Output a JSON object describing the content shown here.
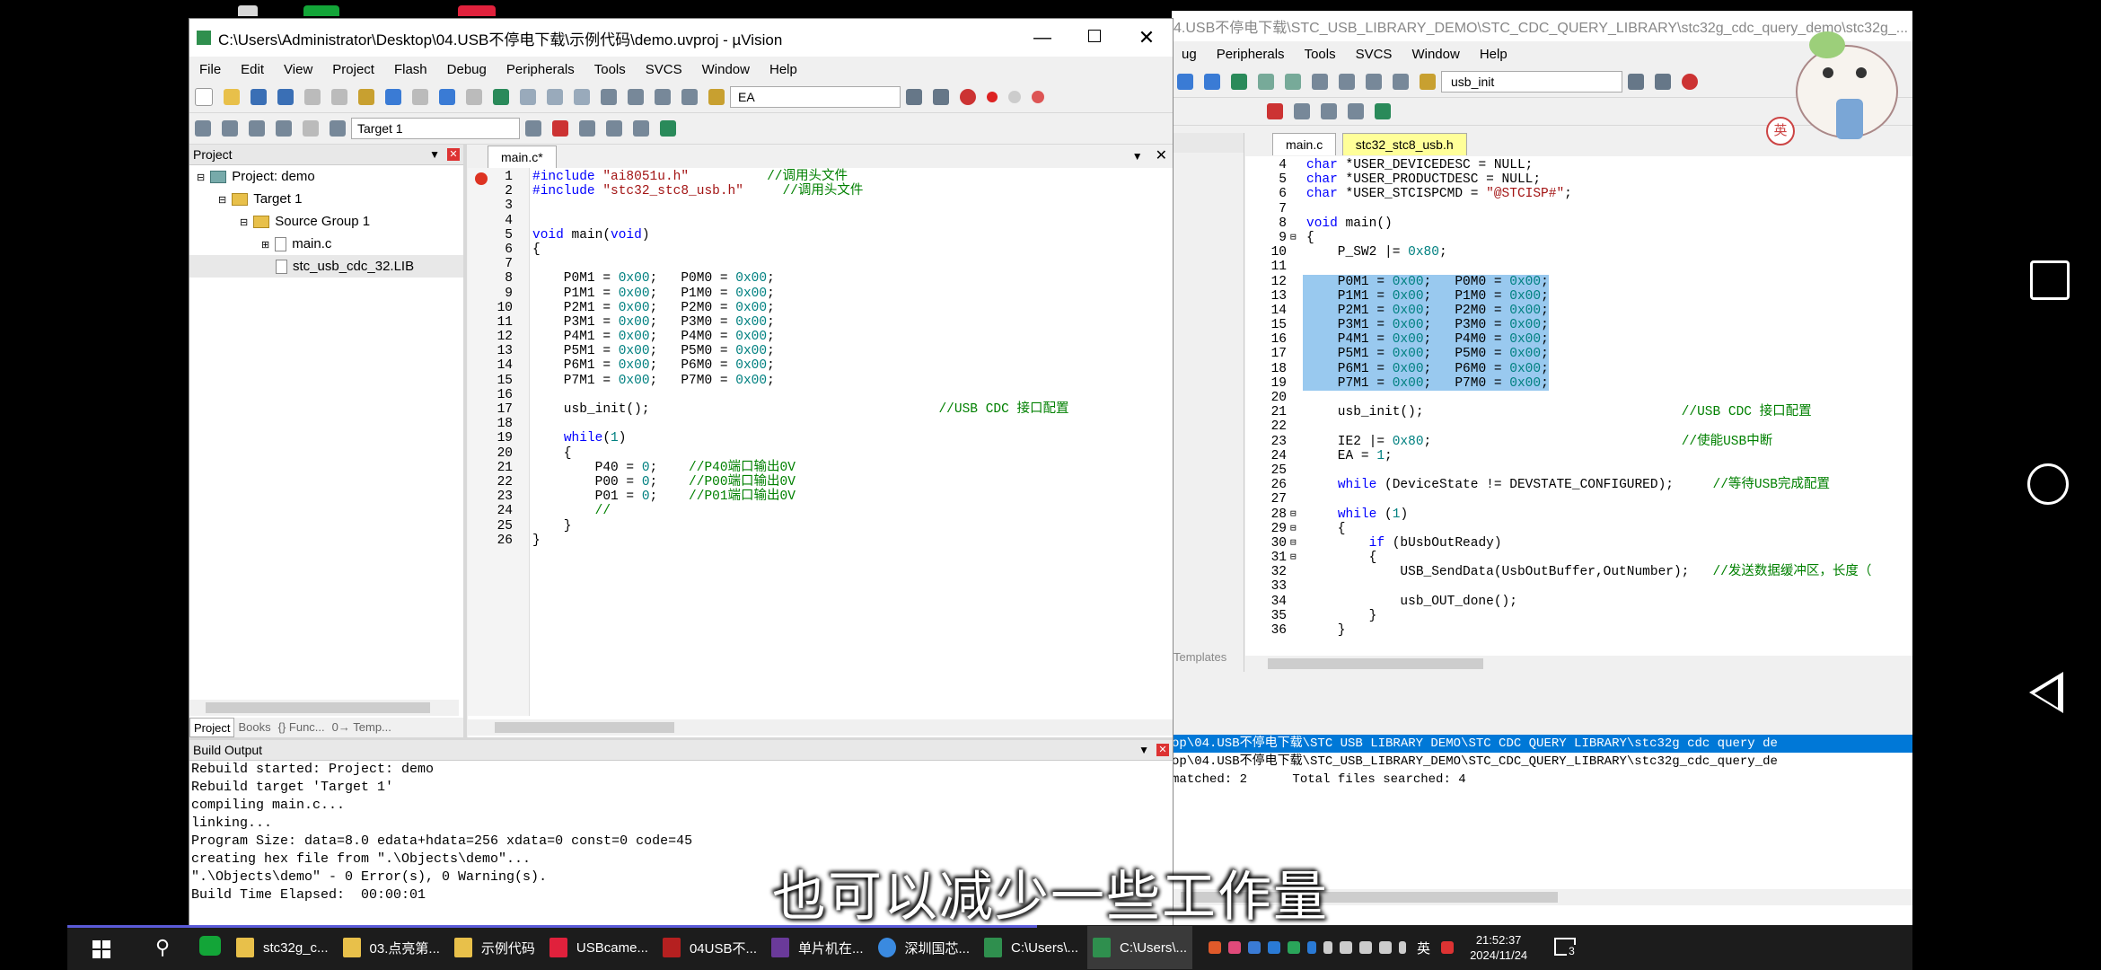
{
  "window1": {
    "title": "C:\\Users\\Administrator\\Desktop\\04.USB不停电下载\\示例代码\\demo.uvproj - µVision",
    "menu": [
      "File",
      "Edit",
      "View",
      "Project",
      "Flash",
      "Debug",
      "Peripherals",
      "Tools",
      "SVCS",
      "Window",
      "Help"
    ],
    "toolbar_search": "EA",
    "target": "Target 1"
  },
  "project": {
    "header": "Project",
    "items": [
      "Project: demo",
      "Target 1",
      "Source Group 1",
      "main.c",
      "stc_usb_cdc_32.LIB"
    ],
    "tabs": [
      "Project",
      "Books",
      "{} Func...",
      "0→ Temp..."
    ]
  },
  "editor1": {
    "tab": "main.c*",
    "lines": [
      {
        "n": "1",
        "code": "#include \"ai8051u.h\"          //调用头文件"
      },
      {
        "n": "2",
        "code": "#include \"stc32_stc8_usb.h\"     //调用头文件"
      },
      {
        "n": "3",
        "code": ""
      },
      {
        "n": "4",
        "code": ""
      },
      {
        "n": "5",
        "code": "void main(void)"
      },
      {
        "n": "6",
        "code": "{"
      },
      {
        "n": "7",
        "code": ""
      },
      {
        "n": "8",
        "code": "    P0M1 = 0x00;   P0M0 = 0x00;"
      },
      {
        "n": "9",
        "code": "    P1M1 = 0x00;   P1M0 = 0x00;"
      },
      {
        "n": "10",
        "code": "    P2M1 = 0x00;   P2M0 = 0x00;"
      },
      {
        "n": "11",
        "code": "    P3M1 = 0x00;   P3M0 = 0x00;"
      },
      {
        "n": "12",
        "code": "    P4M1 = 0x00;   P4M0 = 0x00;"
      },
      {
        "n": "13",
        "code": "    P5M1 = 0x00;   P5M0 = 0x00;"
      },
      {
        "n": "14",
        "code": "    P6M1 = 0x00;   P6M0 = 0x00;"
      },
      {
        "n": "15",
        "code": "    P7M1 = 0x00;   P7M0 = 0x00;"
      },
      {
        "n": "16",
        "code": ""
      },
      {
        "n": "17",
        "code": "    usb_init();                                     //USB CDC 接口配置"
      },
      {
        "n": "18",
        "code": ""
      },
      {
        "n": "19",
        "code": "    while(1)"
      },
      {
        "n": "20",
        "code": "    {"
      },
      {
        "n": "21",
        "code": "        P40 = 0;    //P40端口输出0V"
      },
      {
        "n": "22",
        "code": "        P00 = 0;    //P00端口输出0V"
      },
      {
        "n": "23",
        "code": "        P01 = 0;    //P01端口输出0V"
      },
      {
        "n": "24",
        "code": "        //"
      },
      {
        "n": "25",
        "code": "    }"
      },
      {
        "n": "26",
        "code": "}"
      }
    ]
  },
  "build": {
    "header": "Build Output",
    "lines": [
      "Rebuild started: Project: demo",
      "Rebuild target 'Target 1'",
      "compiling main.c...",
      "linking...",
      "Program Size: data=8.0 edata+hdata=256 xdata=0 const=0 code=45",
      "creating hex file from \".\\Objects\\demo\"...",
      "\".\\Objects\\demo\" - 0 Error(s), 0 Warning(s).",
      "Build Time Elapsed:  00:00:01"
    ]
  },
  "window2": {
    "title": "4.USB不停电下载\\STC_USB_LIBRARY_DEMO\\STC_CDC_QUERY_LIBRARY\\stc32g_cdc_query_demo\\stc32g_...",
    "menu": [
      "ug",
      "Peripherals",
      "Tools",
      "SVCS",
      "Window",
      "Help"
    ],
    "toolbar_search": "usb_init",
    "tabs": [
      "main.c",
      "stc32_stc8_usb.h"
    ],
    "side_tab": "Templates",
    "lines": [
      {
        "n": "4",
        "code": "char *USER_DEVICEDESC = NULL;"
      },
      {
        "n": "5",
        "code": "char *USER_PRODUCTDESC = NULL;"
      },
      {
        "n": "6",
        "code": "char *USER_STCISPCMD = \"@STCISP#\";"
      },
      {
        "n": "7",
        "code": ""
      },
      {
        "n": "8",
        "code": "void main()"
      },
      {
        "n": "9",
        "code": "{"
      },
      {
        "n": "10",
        "code": "    P_SW2 |= 0x80;"
      },
      {
        "n": "11",
        "code": ""
      },
      {
        "n": "12",
        "code": "    P0M1 = 0x00;   P0M0 = 0x00;"
      },
      {
        "n": "13",
        "code": "    P1M1 = 0x00;   P1M0 = 0x00;"
      },
      {
        "n": "14",
        "code": "    P2M1 = 0x00;   P2M0 = 0x00;"
      },
      {
        "n": "15",
        "code": "    P3M1 = 0x00;   P3M0 = 0x00;"
      },
      {
        "n": "16",
        "code": "    P4M1 = 0x00;   P4M0 = 0x00;"
      },
      {
        "n": "17",
        "code": "    P5M1 = 0x00;   P5M0 = 0x00;"
      },
      {
        "n": "18",
        "code": "    P6M1 = 0x00;   P6M0 = 0x00;"
      },
      {
        "n": "19",
        "code": "    P7M1 = 0x00;   P7M0 = 0x00;"
      },
      {
        "n": "20",
        "code": ""
      },
      {
        "n": "21",
        "code": "    usb_init();                                 //USB CDC 接口配置"
      },
      {
        "n": "22",
        "code": ""
      },
      {
        "n": "23",
        "code": "    IE2 |= 0x80;                                //使能USB中断"
      },
      {
        "n": "24",
        "code": "    EA = 1;"
      },
      {
        "n": "25",
        "code": ""
      },
      {
        "n": "26",
        "code": "    while (DeviceState != DEVSTATE_CONFIGURED);     //等待USB完成配置"
      },
      {
        "n": "27",
        "code": ""
      },
      {
        "n": "28",
        "code": "    while (1)"
      },
      {
        "n": "29",
        "code": "    {"
      },
      {
        "n": "30",
        "code": "        if (bUsbOutReady)"
      },
      {
        "n": "31",
        "code": "        {"
      },
      {
        "n": "32",
        "code": "            USB_SendData(UsbOutBuffer,OutNumber);   //发送数据缓冲区，长度（"
      },
      {
        "n": "33",
        "code": ""
      },
      {
        "n": "34",
        "code": "            usb_OUT_done();"
      },
      {
        "n": "35",
        "code": "        }"
      },
      {
        "n": "36",
        "code": "    }"
      }
    ],
    "find_lines": [
      "op\\04.USB不停电下载\\STC USB LIBRARY DEMO\\STC CDC QUERY LIBRARY\\stc32g cdc query de",
      "op\\04.USB不停电下载\\STC_USB_LIBRARY_DEMO\\STC_CDC_QUERY_LIBRARY\\stc32g_cdc_query_de",
      "matched: 2      Total files searched: 4"
    ]
  },
  "subtitle": "也可以减少一些工作量",
  "ime": {
    "a": "英"
  },
  "taskbar": {
    "items": [
      "stc32g_c...",
      "03.点亮第...",
      "示例代码",
      "USBcame...",
      "04USB不...",
      "单片机在...",
      "深圳国芯...",
      "C:\\Users\\...",
      "C:\\Users\\..."
    ],
    "time": "21:52:37",
    "date": "2024/11/24",
    "ime": "英",
    "notif": "3"
  },
  "colors": {
    "accent": "#0078d7",
    "selection": "#99c9ef",
    "taskbar": "#1c1c1c"
  }
}
